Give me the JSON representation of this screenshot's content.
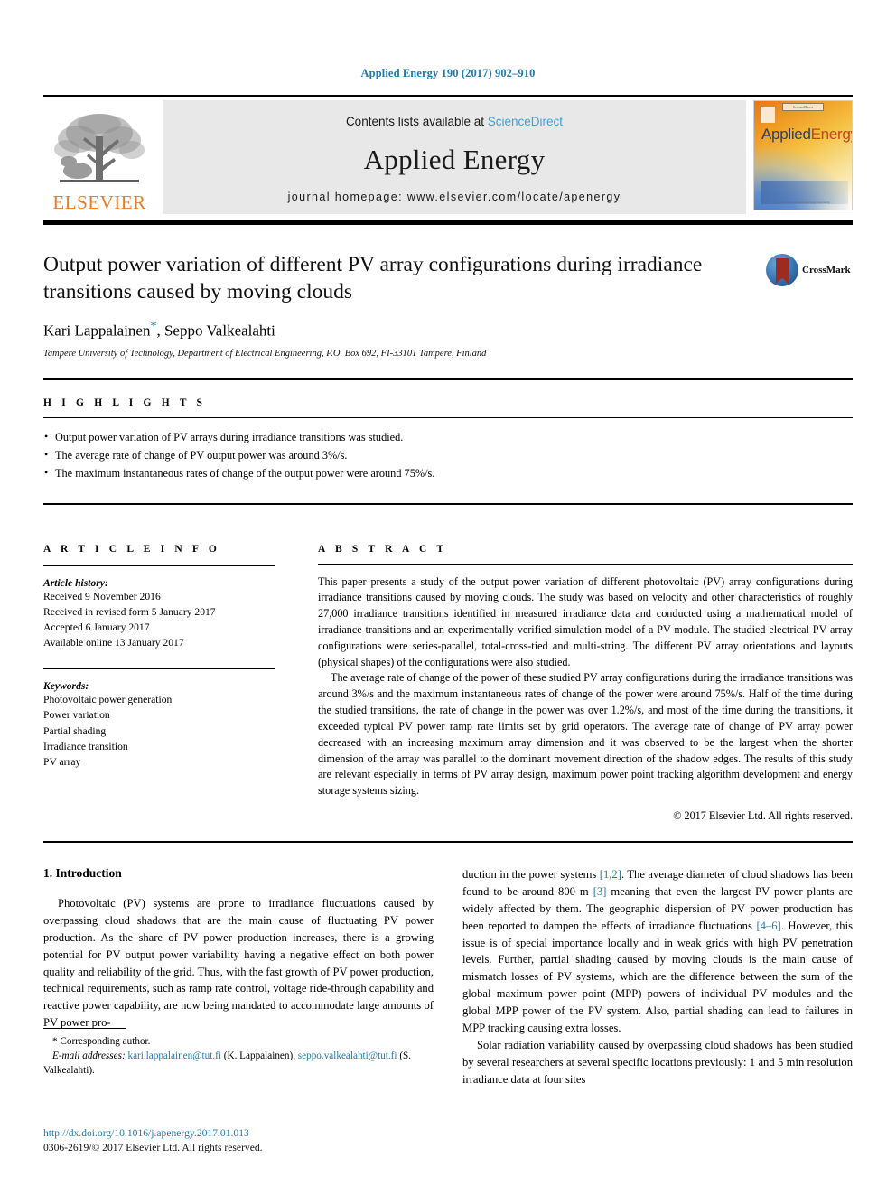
{
  "running_head": "Applied Energy 190 (2017) 902–910",
  "masthead": {
    "contents_prefix": "Contents lists available at ",
    "sciencedirect": "ScienceDirect",
    "journal_title": "Applied Energy",
    "homepage": "journal homepage: www.elsevier.com/locate/apenergy",
    "publisher_logo_text": "ELSEVIER",
    "cover": {
      "title_part1": "Applied",
      "title_part2": "Energy",
      "footer_text": "journal of the international energy community",
      "footer_badge": "ScienceDirect"
    }
  },
  "article": {
    "title": "Output power variation of different PV array configurations during irradiance transitions caused by moving clouds",
    "authors": "Kari Lappalainen",
    "authors_rest": ", Seppo Valkealahti",
    "corresponding_marker": "*",
    "affiliation": "Tampere University of Technology, Department of Electrical Engineering, P.O. Box 692, FI-33101 Tampere, Finland",
    "crossmark_label": "CrossMark"
  },
  "highlights": {
    "heading": "H I G H L I G H T S",
    "items": [
      "Output power variation of PV arrays during irradiance transitions was studied.",
      "The average rate of change of PV output power was around 3%/s.",
      "The maximum instantaneous rates of change of the output power were around 75%/s."
    ]
  },
  "article_info": {
    "heading": "A R T I C L E   I N F O",
    "history_label": "Article history:",
    "history": [
      "Received 9 November 2016",
      "Received in revised form 5 January 2017",
      "Accepted 6 January 2017",
      "Available online 13 January 2017"
    ],
    "keywords_label": "Keywords:",
    "keywords": [
      "Photovoltaic power generation",
      "Power variation",
      "Partial shading",
      "Irradiance transition",
      "PV array"
    ]
  },
  "abstract": {
    "heading": "A B S T R A C T",
    "paragraphs": [
      "This paper presents a study of the output power variation of different photovoltaic (PV) array configurations during irradiance transitions caused by moving clouds. The study was based on velocity and other characteristics of roughly 27,000 irradiance transitions identified in measured irradiance data and conducted using a mathematical model of irradiance transitions and an experimentally verified simulation model of a PV module. The studied electrical PV array configurations were series-parallel, total-cross-tied and multi-string. The different PV array orientations and layouts (physical shapes) of the configurations were also studied.",
      "The average rate of change of the power of these studied PV array configurations during the irradiance transitions was around 3%/s and the maximum instantaneous rates of change of the power were around 75%/s. Half of the time during the studied transitions, the rate of change in the power was over 1.2%/s, and most of the time during the transitions, it exceeded typical PV power ramp rate limits set by grid operators. The average rate of change of PV array power decreased with an increasing maximum array dimension and it was observed to be the largest when the shorter dimension of the array was parallel to the dominant movement direction of the shadow edges. The results of this study are relevant especially in terms of PV array design, maximum power point tracking algorithm development and energy storage systems sizing."
    ],
    "copyright": "© 2017 Elsevier Ltd. All rights reserved."
  },
  "introduction": {
    "heading": "1. Introduction",
    "left_paragraph": "Photovoltaic (PV) systems are prone to irradiance fluctuations caused by overpassing cloud shadows that are the main cause of fluctuating PV power production. As the share of PV power production increases, there is a growing potential for PV output power variability having a negative effect on both power quality and reliability of the grid. Thus, with the fast growth of PV power production, technical requirements, such as ramp rate control, voltage ride-through capability and reactive power capability, are now being mandated to accommodate large amounts of PV power pro-",
    "right_paragraph_1_a": "duction in the power systems ",
    "right_ref_1": "[1,2]",
    "right_paragraph_1_b": ". The average diameter of cloud shadows has been found to be around 800 m ",
    "right_ref_2": "[3]",
    "right_paragraph_1_c": " meaning that even the largest PV power plants are widely affected by them. The geographic dispersion of PV power production has been reported to dampen the effects of irradiance fluctuations ",
    "right_ref_3": "[4–6]",
    "right_paragraph_1_d": ". However, this issue is of special importance locally and in weak grids with high PV penetration levels. Further, partial shading caused by moving clouds is the main cause of mismatch losses of PV systems, which are the difference between the sum of the global maximum power point (MPP) powers of individual PV modules and the global MPP power of the PV system. Also, partial shading can lead to failures in MPP tracking causing extra losses.",
    "right_paragraph_2": "Solar radiation variability caused by overpassing cloud shadows has been studied by several researchers at several specific locations previously: 1 and 5 min resolution irradiance data at four sites"
  },
  "footnote": {
    "corresponding": "* Corresponding author.",
    "email_label": "E-mail addresses:",
    "email_1": "kari.lappalainen@tut.fi",
    "email_1_owner": " (K. Lappalainen), ",
    "email_2": "seppo.valkealahti@tut.fi",
    "email_2_owner": " (S. Valkealahti)."
  },
  "doi": {
    "url": "http://dx.doi.org/10.1016/j.apenergy.2017.01.013",
    "issn_line": "0306-2619/© 2017 Elsevier Ltd. All rights reserved."
  },
  "colors": {
    "link_blue": "#1f7bad",
    "sciencedirect_blue": "#3ca2dd",
    "elsevier_orange": "#ec7c26",
    "band_gray": "#e8e8e8"
  }
}
